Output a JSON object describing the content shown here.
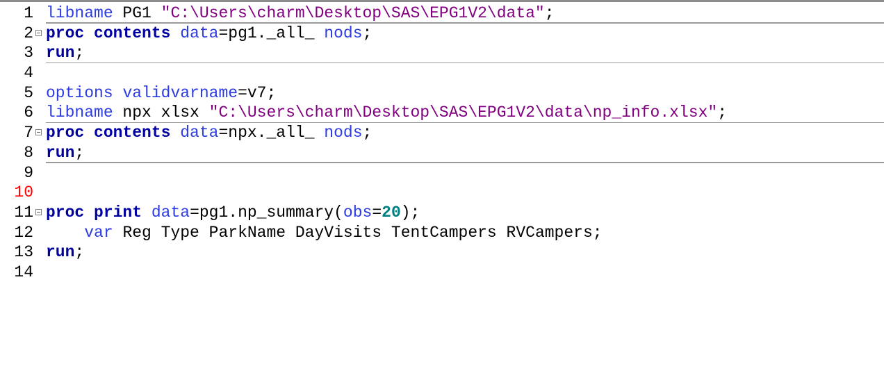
{
  "editor": {
    "current_line": 10,
    "colors": {
      "keyword": "#0000a0",
      "option": "#2c3ce0",
      "string": "#800080",
      "number": "#008080",
      "current_line_number": "#ff0000"
    },
    "lines": [
      {
        "num": "1",
        "fold": false,
        "sep": true,
        "tokens": [
          [
            "libname",
            "opt"
          ],
          [
            " PG1 ",
            "txt"
          ],
          [
            "\"C:\\Users\\charm\\Desktop\\SAS\\EPG1V2\\data\"",
            "str"
          ],
          [
            ";",
            "txt"
          ]
        ]
      },
      {
        "num": "2",
        "fold": true,
        "sep": false,
        "tokens": [
          [
            "proc contents",
            "kw"
          ],
          [
            " ",
            "txt"
          ],
          [
            "data",
            "opt"
          ],
          [
            "=pg1._all_ ",
            "txt"
          ],
          [
            "nods",
            "opt"
          ],
          [
            ";",
            "txt"
          ]
        ]
      },
      {
        "num": "3",
        "fold": false,
        "sep": true,
        "tokens": [
          [
            "run",
            "kw"
          ],
          [
            ";",
            "txt"
          ]
        ]
      },
      {
        "num": "4",
        "fold": false,
        "sep": false,
        "tokens": []
      },
      {
        "num": "5",
        "fold": false,
        "sep": false,
        "tokens": [
          [
            "options",
            "opt"
          ],
          [
            " ",
            "txt"
          ],
          [
            "validvarname",
            "opt"
          ],
          [
            "=v7;",
            "txt"
          ]
        ]
      },
      {
        "num": "6",
        "fold": false,
        "sep": true,
        "tokens": [
          [
            "libname",
            "opt"
          ],
          [
            " npx xlsx ",
            "txt"
          ],
          [
            "\"C:\\Users\\charm\\Desktop\\SAS\\EPG1V2\\data\\np_info.xlsx\"",
            "str"
          ],
          [
            ";",
            "txt"
          ]
        ]
      },
      {
        "num": "7",
        "fold": true,
        "sep": false,
        "tokens": [
          [
            "proc contents",
            "kw"
          ],
          [
            " ",
            "txt"
          ],
          [
            "data",
            "opt"
          ],
          [
            "=npx._all_ ",
            "txt"
          ],
          [
            "nods",
            "opt"
          ],
          [
            ";",
            "txt"
          ]
        ]
      },
      {
        "num": "8",
        "fold": false,
        "sep": true,
        "tokens": [
          [
            "run",
            "kw"
          ],
          [
            ";",
            "txt"
          ]
        ]
      },
      {
        "num": "9",
        "fold": false,
        "sep": false,
        "tokens": []
      },
      {
        "num": "10",
        "fold": false,
        "sep": false,
        "tokens": []
      },
      {
        "num": "11",
        "fold": true,
        "sep": false,
        "tokens": [
          [
            "proc print",
            "kw"
          ],
          [
            " ",
            "txt"
          ],
          [
            "data",
            "opt"
          ],
          [
            "=pg1.np_summary(",
            "txt"
          ],
          [
            "obs",
            "opt"
          ],
          [
            "=",
            "txt"
          ],
          [
            "20",
            "num"
          ],
          [
            ");",
            "txt"
          ]
        ]
      },
      {
        "num": "12",
        "fold": false,
        "sep": false,
        "tokens": [
          [
            "    ",
            "txt"
          ],
          [
            "var",
            "opt"
          ],
          [
            " Reg Type ParkName DayVisits TentCampers RVCampers;",
            "txt"
          ]
        ]
      },
      {
        "num": "13",
        "fold": false,
        "sep": false,
        "tokens": [
          [
            "run",
            "kw"
          ],
          [
            ";",
            "txt"
          ]
        ]
      },
      {
        "num": "14",
        "fold": false,
        "sep": false,
        "tokens": []
      }
    ]
  }
}
